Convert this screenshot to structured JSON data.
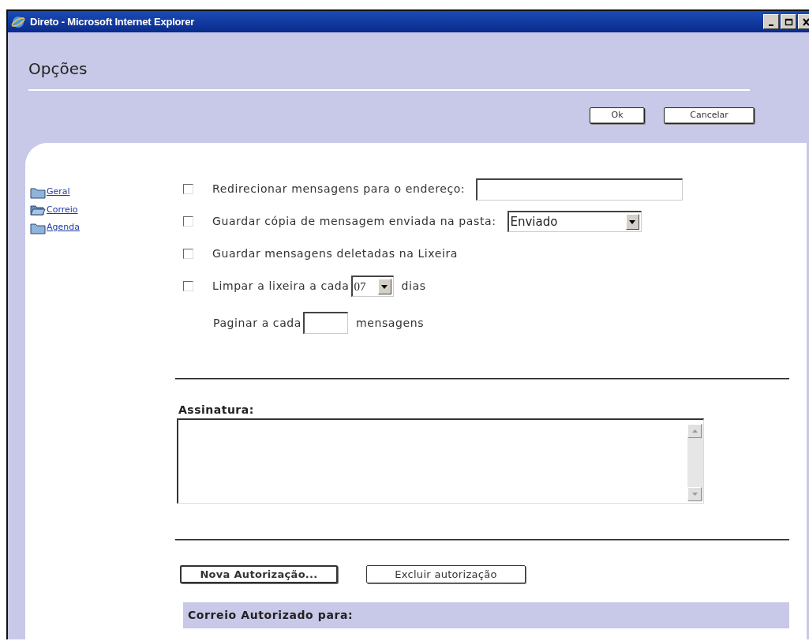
{
  "window": {
    "title": "Direto - Microsoft Internet Explorer"
  },
  "header": {
    "title": "Opções",
    "buttons": [
      "Ok",
      "Cancelar"
    ]
  },
  "sidebar": {
    "items": [
      {
        "label": "Geral",
        "kind": "closed"
      },
      {
        "label": "Correio",
        "kind": "open"
      },
      {
        "label": "Agenda",
        "kind": "closed"
      }
    ]
  },
  "options": [
    {
      "checked": false,
      "label": "Redirecionar mensagens para o endereço:",
      "field": {
        "kind": "text"
      }
    },
    {
      "checked": false,
      "label": "Guardar cópia de mensagem enviada na pasta:",
      "field": {
        "kind": "select",
        "value": "Enviado"
      }
    },
    {
      "checked": false,
      "label": "Guardar mensagens deletadas na Lixeira"
    },
    {
      "checked": false,
      "label": "Limpar a lixeira a cada",
      "field": {
        "kind": "select",
        "value": "07"
      },
      "suffix": "dias"
    },
    {
      "label": "Paginar a cada",
      "field": {
        "kind": "text"
      },
      "suffix": "mensagens"
    }
  ],
  "signature": {
    "label": "Assinatura:"
  },
  "authorization": {
    "buttons": [
      {
        "label": "Nova Autorização...",
        "default": true
      },
      {
        "label": "Excluir autorização",
        "default": false
      }
    ],
    "list_header": "Correio Autorizado para:"
  }
}
